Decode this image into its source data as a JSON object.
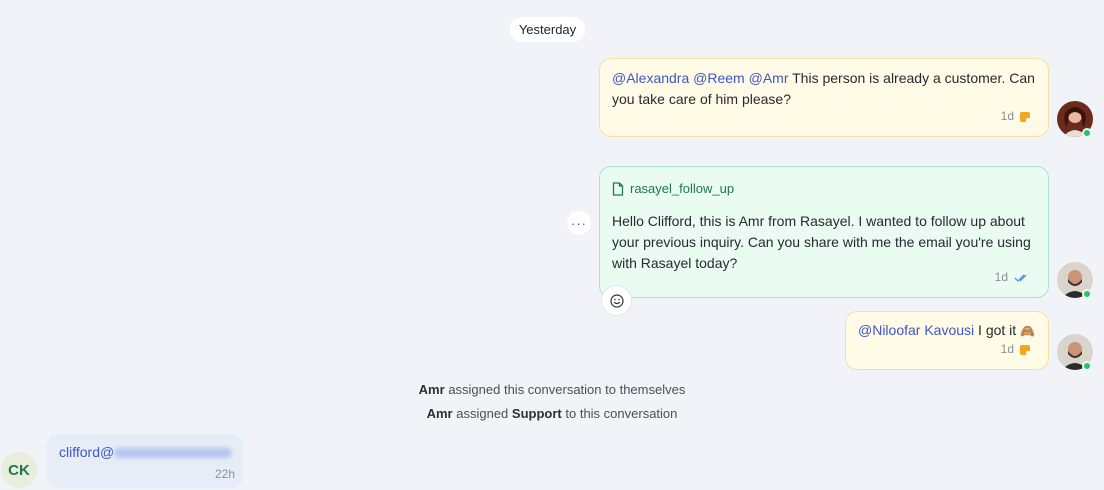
{
  "day_separator": "Yesterday",
  "messages": {
    "note1": {
      "mentions": [
        "@Alexandra",
        "@Reem",
        "@Amr"
      ],
      "text": "This person is already a customer. Can you take care of him please?",
      "time": "1d"
    },
    "template": {
      "name": "rasayel_follow_up",
      "text": "Hello Clifford, this is Amr from Rasayel. I wanted to follow up about your previous inquiry. Can you share with me the email you're using with Rasayel today?",
      "time": "1d",
      "more": "···"
    },
    "note2": {
      "mention": "@Niloofar Kavousi",
      "text": "I got it",
      "emoji": "🙈",
      "time": "1d"
    },
    "incoming": {
      "email_prefix": "clifford@",
      "time": "22h"
    }
  },
  "system": {
    "line1": {
      "actor": "Amr",
      "text": "assigned this conversation to themselves"
    },
    "line2": {
      "actor": "Amr",
      "pre": "assigned",
      "target": "Support",
      "post": "to this conversation"
    }
  },
  "contact": {
    "initials": "CK"
  },
  "colors": {
    "background": "#f1f3f8",
    "note_bg": "#fffbe6",
    "template_bg": "#eafbf1",
    "mention": "#3d57c8",
    "online": "#22c55e"
  }
}
